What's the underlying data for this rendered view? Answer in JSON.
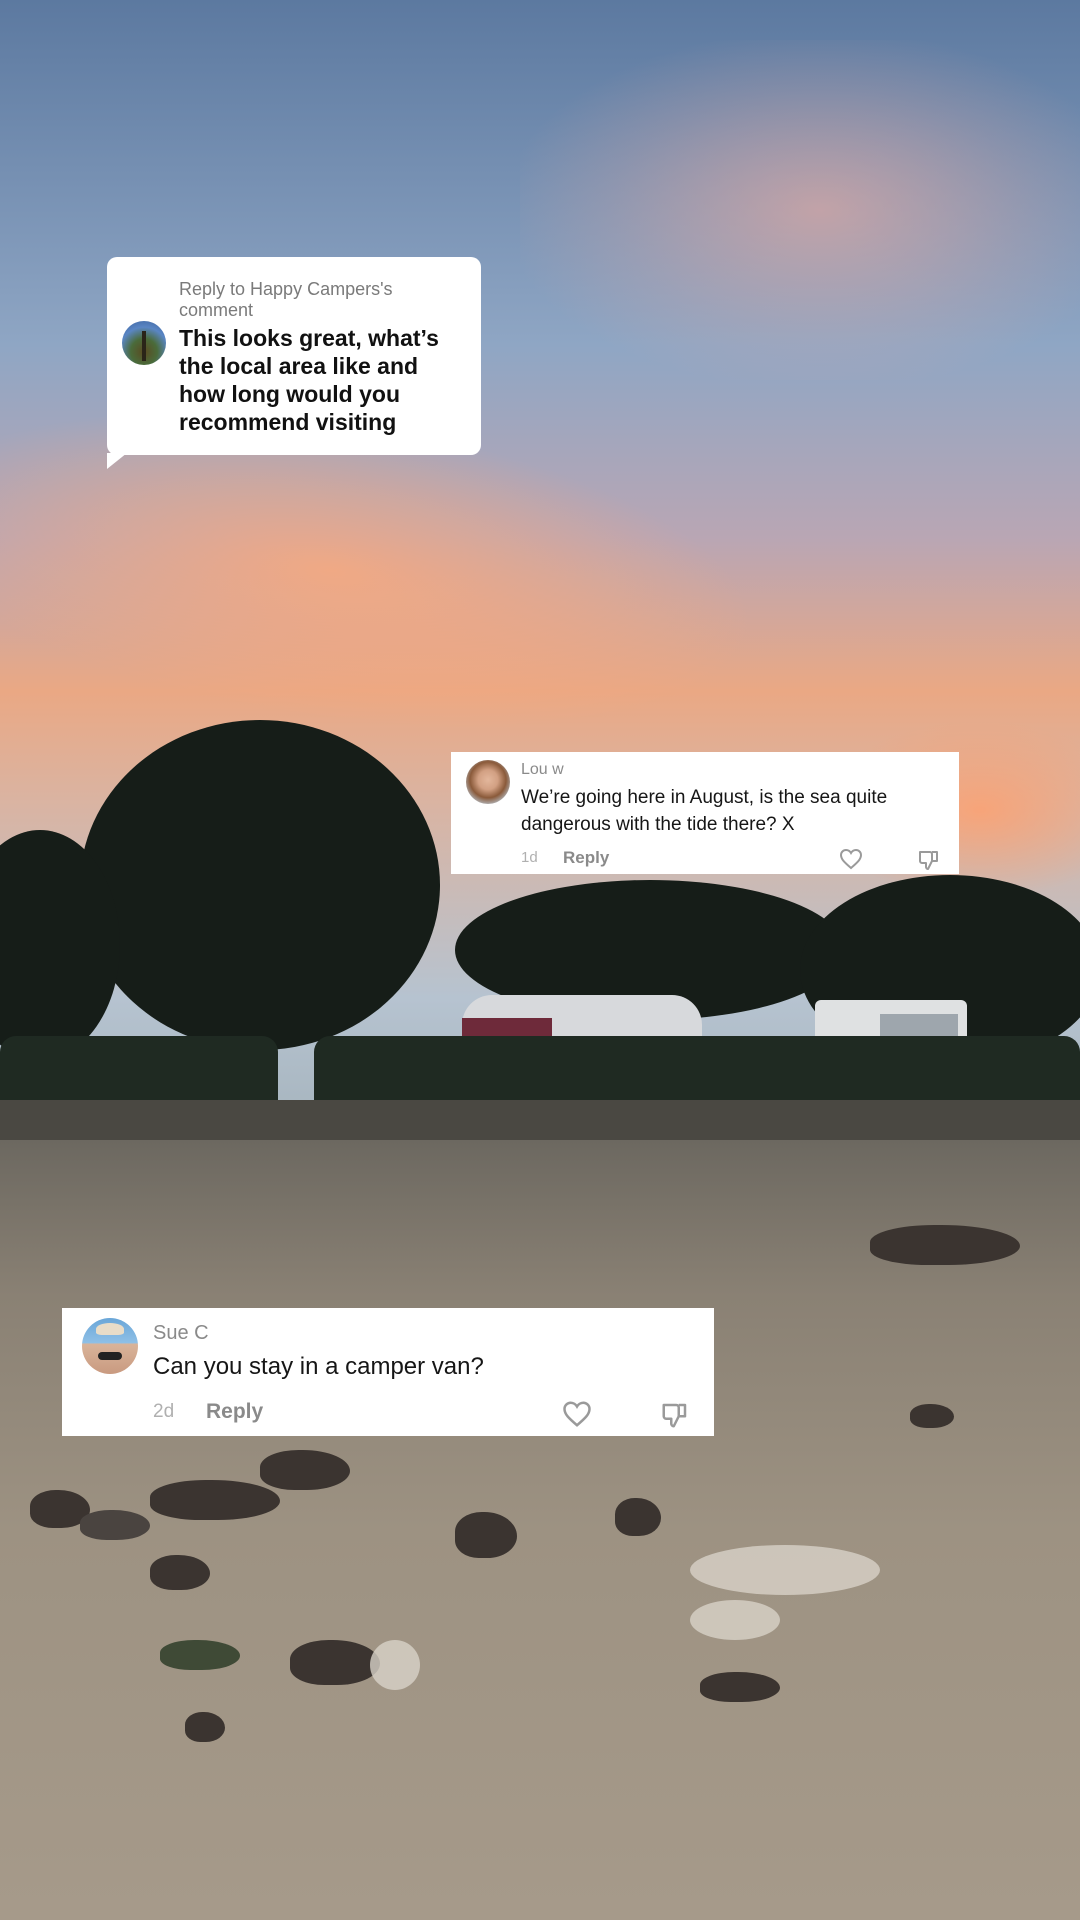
{
  "reply_bubble": {
    "header": "Reply to Happy Campers's comment",
    "text": "This looks great, what’s the local area like and how long would you recommend visiting",
    "avatar_icon": "palm-tree-avatar"
  },
  "comments": [
    {
      "username": "Lou w",
      "text": "We’re going here in August, is the sea quite dangerous with the tide there? X",
      "time": "1d",
      "reply_label": "Reply",
      "like_icon": "heart-icon",
      "dislike_icon": "thumbs-down-icon"
    },
    {
      "username": "Sue C",
      "text": "Can you stay in a camper van?",
      "time": "2d",
      "reply_label": "Reply",
      "like_icon": "heart-icon",
      "dislike_icon": "thumbs-down-icon"
    }
  ],
  "colors": {
    "card_background": "#ffffff",
    "muted_text": "#8a8a8a",
    "body_text": "#161616"
  }
}
